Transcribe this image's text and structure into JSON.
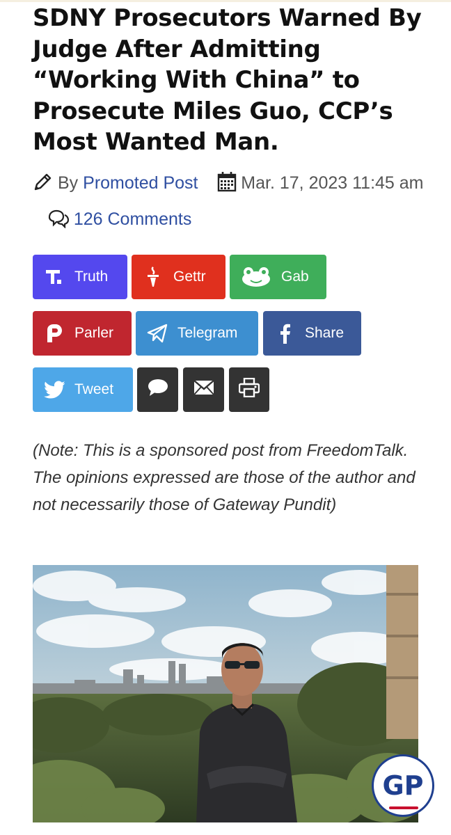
{
  "article": {
    "title": "SDNY Prosecutors Warned By Judge After Admitting “Working With China” to Prosecute Miles Guo, CCP’s Most Wanted Man.",
    "by_label": "By",
    "author": "Promoted Post",
    "date": "Mar. 17, 2023 11:45 am",
    "comments": "126 Comments"
  },
  "share_buttons": [
    {
      "label": "Truth",
      "icon": "truth-icon",
      "color": "#5448ee"
    },
    {
      "label": "Gettr",
      "icon": "gettr-icon",
      "color": "#e0301e"
    },
    {
      "label": "Gab",
      "icon": "gab-icon",
      "color": "#3fae5a"
    },
    {
      "label": "Parler",
      "icon": "parler-icon",
      "color": "#c0262f"
    },
    {
      "label": "Telegram",
      "icon": "telegram-icon",
      "color": "#3d8fd0"
    },
    {
      "label": "Share",
      "icon": "facebook-icon",
      "color": "#3b5998"
    },
    {
      "label": "Tweet",
      "icon": "twitter-icon",
      "color": "#4ea7e8"
    }
  ],
  "icon_buttons": [
    {
      "icon": "comment-icon",
      "color": "#333333"
    },
    {
      "icon": "email-icon",
      "color": "#333333"
    },
    {
      "icon": "print-icon",
      "color": "#333333"
    }
  ],
  "note": "(Note: This is a sponsored post from FreedomTalk. The opinions expressed are those of the author and not necessarily those of Gateway Pundit)",
  "badge": {
    "text": "GP",
    "color": "#1f3f8f",
    "accent": "#c8102e"
  }
}
